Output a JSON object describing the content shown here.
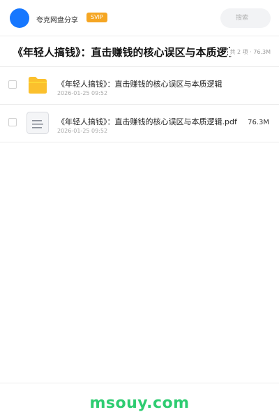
{
  "header": {
    "app_name": "夸克网盘分享",
    "badge": "SVIP",
    "search_placeholder": "搜索"
  },
  "share": {
    "title": "《年轻人搞钱》：直击赚钱的核心误区与本质逻辑",
    "meta": "共 2 项 · 76.3M"
  },
  "files": [
    {
      "type": "folder",
      "name": "《年轻人搞钱》：直击赚钱的核心误区与本质逻辑",
      "date": "2026-01-25 09:52",
      "size": ""
    },
    {
      "type": "pdf",
      "name": "《年轻人搞钱》：直击赚钱的核心误区与本质逻辑.pdf",
      "date": "2026-01-25 09:52",
      "size": "76.3M"
    }
  ],
  "footer": {
    "brand": "msouy.com"
  },
  "colors": {
    "accent": "#1677ff",
    "badge": "#f5a623",
    "folder": "#fbc02d",
    "brand": "#2ecc71"
  },
  "icons": {
    "avatar": "avatar",
    "folder": "folder-icon",
    "document": "document-icon",
    "checkbox": "checkbox"
  }
}
